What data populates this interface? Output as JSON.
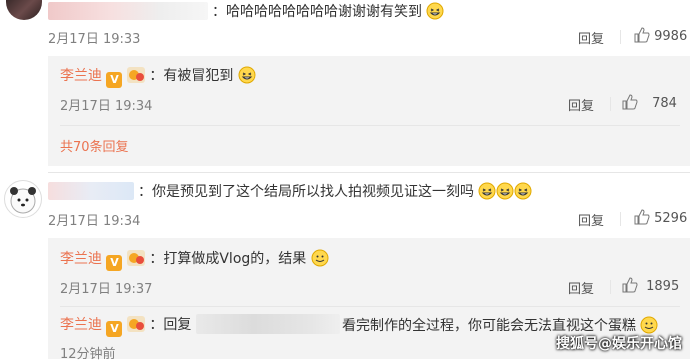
{
  "comments": [
    {
      "text": "：哈哈哈哈哈哈哈哈谢谢谢有笑到",
      "time": "2月17日 19:33",
      "reply_label": "回复",
      "likes": "9986",
      "replies": [
        {
          "name": "李兰迪",
          "text": "：有被冒犯到",
          "time": "2月17日 19:34",
          "reply_label": "回复",
          "likes": "784"
        }
      ],
      "more_label": "共70条回复"
    },
    {
      "text": "：你是预见到了这个结局所以找人拍视频见证这一刻吗",
      "time": "2月17日 19:34",
      "reply_label": "回复",
      "likes": "5296",
      "replies": [
        {
          "name": "李兰迪",
          "text": "：打算做成Vlog的，结果",
          "time": "2月17日 19:37",
          "reply_label": "回复",
          "likes": "1895"
        },
        {
          "name": "李兰迪",
          "text_prefix": "：回复",
          "text_suffix": "看完制作的全过程，你可能会无法直视这个蛋糕",
          "time": "12分钟前"
        }
      ]
    }
  ],
  "verified_badge": "V",
  "watermark": "搜狐号@娱乐开心馆",
  "colors": {
    "name": "#eb7350",
    "reply_bg": "#f3f3f3",
    "badge": "#f5a623",
    "meta": "#808080"
  },
  "icons": [
    "thumbs-up-icon",
    "laughing-emoji-icon",
    "smile-emoji-icon",
    "verified-badge-icon",
    "member-badge-icon"
  ]
}
